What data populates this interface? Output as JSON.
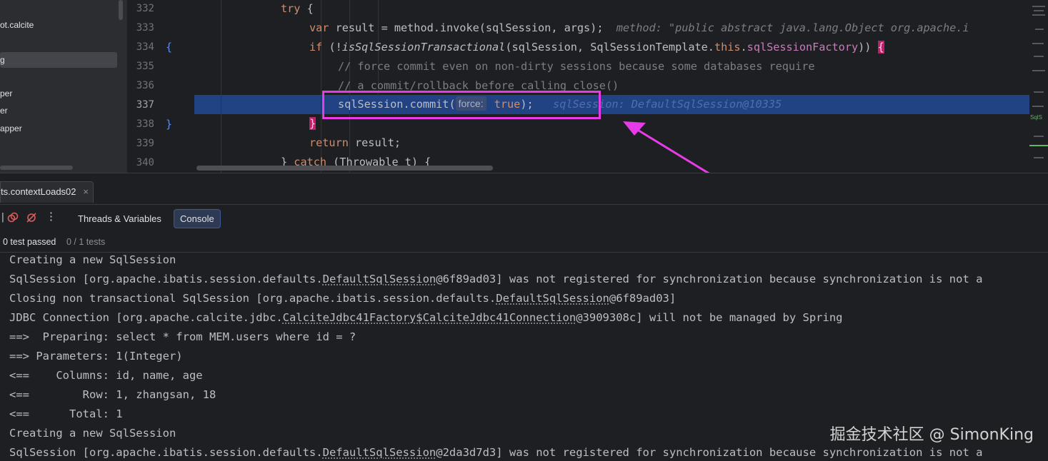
{
  "project_tree": {
    "items": [
      {
        "label": "ot.calcite"
      },
      {
        "label": "g"
      },
      {
        "label": "per"
      },
      {
        "label": "er"
      },
      {
        "label": "apper"
      }
    ]
  },
  "editor": {
    "line_numbers": [
      "332",
      "333",
      "334",
      "335",
      "336",
      "337",
      "338",
      "339",
      "340"
    ],
    "code": {
      "l332": {
        "kw": "try",
        "rest": " {"
      },
      "l333": {
        "kw": "var",
        "a": " result = method.invoke(sqlSession, args);",
        "hint": "  method: \"public abstract java.lang.Object org.apache.i"
      },
      "l334": {
        "kw": "if",
        "a": " (!",
        "method": "isSqlSessionTransactional",
        "b": "(sqlSession, SqlSessionTemplate.",
        "this": "this",
        "dot": ".",
        "field": "sqlSessionFactory",
        "c": ")) ",
        "brace": "{"
      },
      "l335": {
        "comment": "// force commit even on non-dirty sessions because some databases require"
      },
      "l336": {
        "comment": "// a commit/rollback before calling close()"
      },
      "l337": {
        "a": "sqlSession.commit(",
        "inlay": "force:",
        "val": " true",
        "b": ");",
        "hint": "   sqlSession: DefaultSqlSession@10335"
      },
      "l338": {
        "brace": "}"
      },
      "l339": {
        "kw": "return",
        "rest": " result;"
      },
      "l340": {
        "a": "} ",
        "kw": "catch",
        "rest": " (Throwable t) {"
      }
    },
    "gutter_braces": {
      "open": "{",
      "close": "}"
    },
    "minimap_label": "SqlS"
  },
  "run_tab": {
    "label": "ts.contextLoads02",
    "close": "×"
  },
  "debug_toolbar": {
    "tabs": [
      {
        "label": "Threads & Variables",
        "active": false
      },
      {
        "label": "Console",
        "active": true
      }
    ],
    "more": "⋮"
  },
  "test_status": {
    "passed": "0 test passed",
    "count": "0 / 1 tests"
  },
  "console": {
    "lines": [
      {
        "pre": "Creating a new SqlSession",
        "u": "",
        "post": ""
      },
      {
        "pre": "SqlSession [org.apache.ibatis.session.defaults.",
        "u": "DefaultSqlSession",
        "post": "@6f89ad03] was not registered for synchronization because synchronization is not a"
      },
      {
        "pre": "Closing non transactional SqlSession [org.apache.ibatis.session.defaults.",
        "u": "DefaultSqlSession",
        "post": "@6f89ad03]"
      },
      {
        "pre": "JDBC Connection [org.apache.calcite.jdbc.",
        "u": "CalciteJdbc41Factory$CalciteJdbc41Connection",
        "post": "@3909308c] will not be managed by Spring"
      },
      {
        "pre": "==>  Preparing: select * from MEM.users where id = ?",
        "u": "",
        "post": ""
      },
      {
        "pre": "==> Parameters: 1(Integer)",
        "u": "",
        "post": ""
      },
      {
        "pre": "<==    Columns: id, name, age",
        "u": "",
        "post": ""
      },
      {
        "pre": "<==        Row: 1, zhangsan, 18",
        "u": "",
        "post": ""
      },
      {
        "pre": "<==      Total: 1",
        "u": "",
        "post": ""
      },
      {
        "pre": "Creating a new SqlSession",
        "u": "",
        "post": ""
      },
      {
        "pre": "SqlSession [org.apache.ibatis.session.defaults.",
        "u": "DefaultSqlSession",
        "post": "@2da3d7d3] was not registered for synchronization because synchronization is not a"
      }
    ]
  },
  "watermark": "掘金技术社区 @ SimonKing",
  "colors": {
    "highlight": "#214283",
    "annotation": "#e83be8",
    "keyword": "#cf8e6d"
  }
}
